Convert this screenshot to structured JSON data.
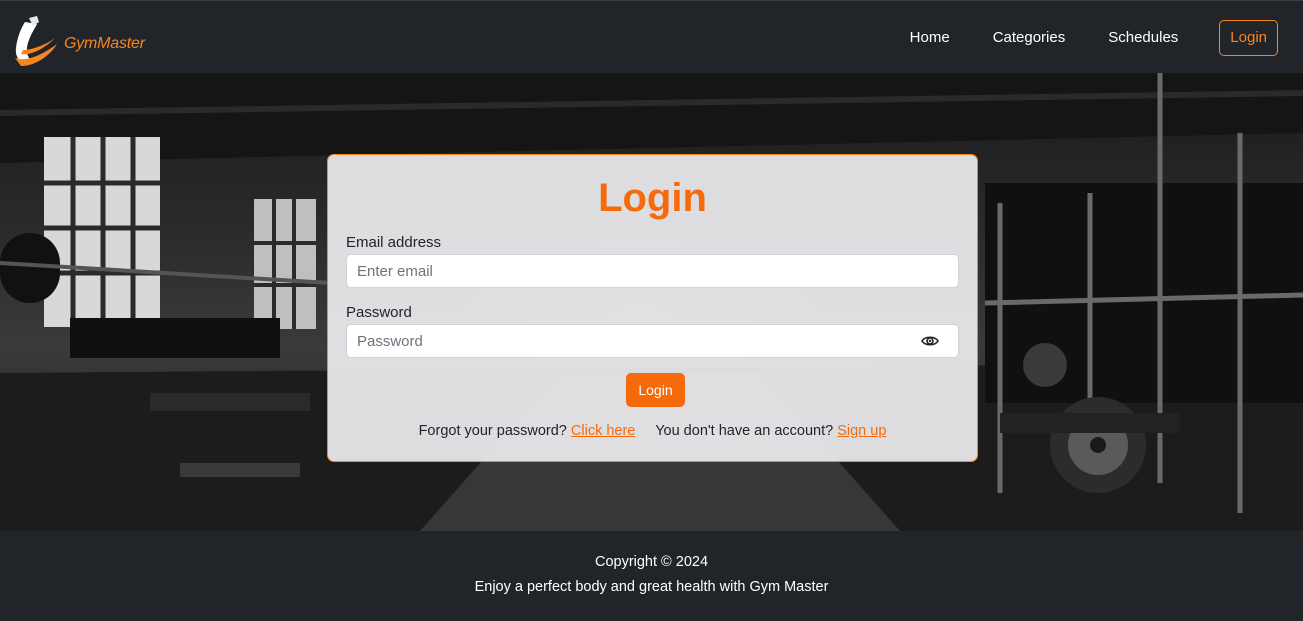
{
  "brand": {
    "name": "GymMaster",
    "accent_color": "#f7861c",
    "logo_icon": "flexed-arm-icon"
  },
  "nav": {
    "items": [
      {
        "label": "Home"
      },
      {
        "label": "Categories"
      },
      {
        "label": "Schedules"
      }
    ],
    "login_label": "Login"
  },
  "login": {
    "title": "Login",
    "email_label": "Email address",
    "email_placeholder": "Enter email",
    "email_value": "",
    "password_label": "Password",
    "password_placeholder": "Password",
    "password_value": "",
    "toggle_icon": "eye-icon",
    "submit_label": "Login",
    "forgot_text": "Forgot your password?",
    "forgot_link": "Click here",
    "signup_text": "You don't have an account?",
    "signup_link": "Sign up",
    "accent_color": "#f76a0c"
  },
  "footer": {
    "copyright": "Copyright © 2024",
    "tagline": "Enjoy a perfect body and great health with Gym Master"
  }
}
